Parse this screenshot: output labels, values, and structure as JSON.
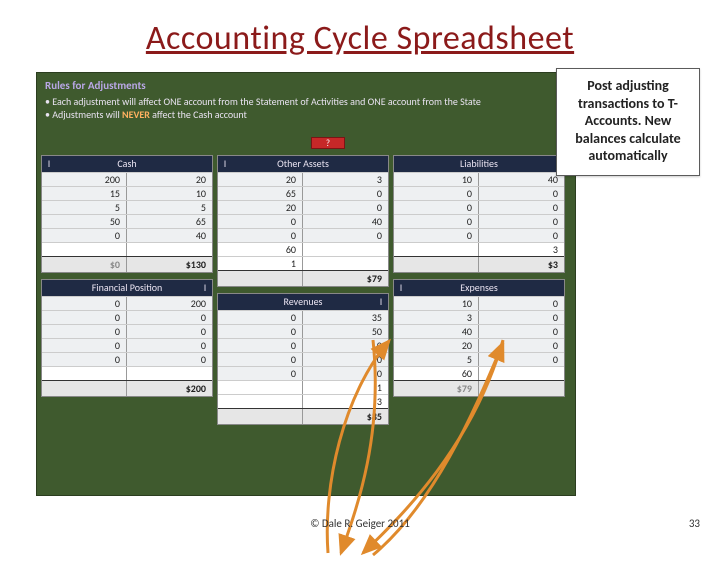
{
  "title": "Accounting Cycle Spreadsheet",
  "rules": {
    "heading": "Rules for Adjustments",
    "line1_pre": "• Each adjustment will affect ONE account from the Statement of Activities and ONE account from the State",
    "line2_pre": "• Adjustments will ",
    "line2_never": "NEVER",
    "line2_post": " affect the Cash account"
  },
  "redflag": "?",
  "callout": "Post adjusting transactions to T-Accounts. New balances calculate automatically",
  "copyright": "© Dale R. Geiger 2011",
  "page": "33",
  "accounts": {
    "cash": {
      "title": "Cash",
      "hl": "I",
      "hr": "",
      "rows": [
        [
          "200",
          "20"
        ],
        [
          "15",
          "10"
        ],
        [
          "5",
          "5"
        ],
        [
          "50",
          "65"
        ],
        [
          "0",
          "40"
        ]
      ],
      "adj": [
        [
          "",
          ""
        ]
      ],
      "total_l": "$0",
      "total_r": "$130"
    },
    "other": {
      "title": "Other Assets",
      "hl": "I",
      "hr": "",
      "rows": [
        [
          "20",
          "3"
        ],
        [
          "65",
          "0"
        ],
        [
          "20",
          "0"
        ],
        [
          "0",
          "40"
        ],
        [
          "0",
          "0"
        ]
      ],
      "adj": [
        [
          "60",
          ""
        ],
        [
          "1",
          ""
        ]
      ],
      "total_l": "",
      "total_r": "$79"
    },
    "liab": {
      "title": "Liabilities",
      "hl": "",
      "hr": "I",
      "rows": [
        [
          "10",
          "40"
        ],
        [
          "0",
          "0"
        ],
        [
          "0",
          "0"
        ],
        [
          "0",
          "0"
        ],
        [
          "0",
          "0"
        ]
      ],
      "adj": [
        [
          "",
          "3"
        ]
      ],
      "total_l": "",
      "total_r": "$3"
    },
    "finpos": {
      "title": "Financial Position",
      "hl": "",
      "hr": "I",
      "rows": [
        [
          "0",
          "200"
        ],
        [
          "0",
          "0"
        ],
        [
          "0",
          "0"
        ],
        [
          "0",
          "0"
        ],
        [
          "0",
          "0"
        ]
      ],
      "adj": [
        [
          "",
          ""
        ]
      ],
      "total_l": "",
      "total_r": "$200"
    },
    "rev": {
      "title": "Revenues",
      "hl": "",
      "hr": "I",
      "rows": [
        [
          "0",
          "35"
        ],
        [
          "0",
          "50"
        ],
        [
          "0",
          "0"
        ],
        [
          "0",
          "0"
        ],
        [
          "0",
          "0"
        ]
      ],
      "adj": [
        [
          "",
          "1"
        ],
        [
          "",
          "3"
        ]
      ],
      "total_l": "",
      "total_r": "$85"
    },
    "exp": {
      "title": "Expenses",
      "hl": "I",
      "hr": "",
      "rows": [
        [
          "10",
          "0"
        ],
        [
          "3",
          "0"
        ],
        [
          "40",
          "0"
        ],
        [
          "20",
          "0"
        ],
        [
          "5",
          "0"
        ]
      ],
      "adj": [
        [
          "60",
          ""
        ]
      ],
      "total_l": "$79",
      "total_r": ""
    }
  }
}
